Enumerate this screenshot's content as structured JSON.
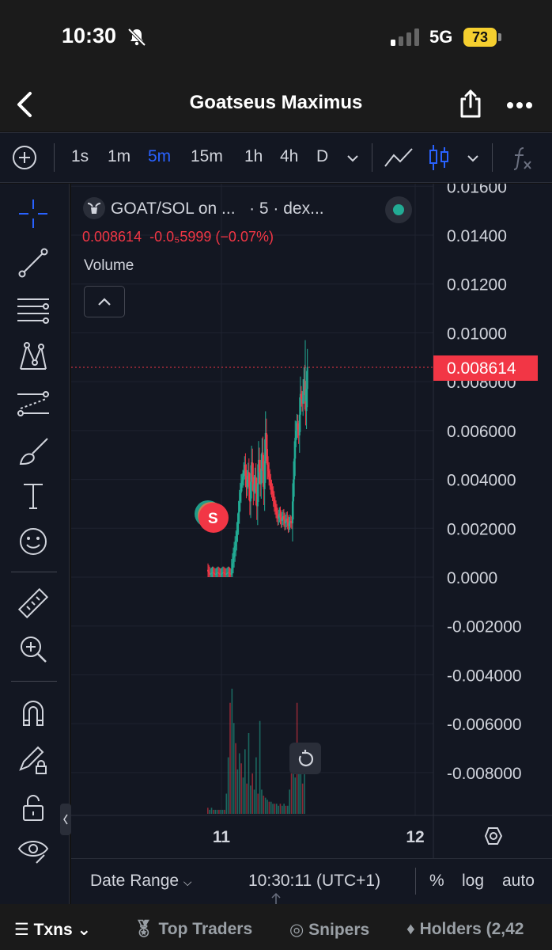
{
  "status_bar": {
    "time": "10:30",
    "network": "5G",
    "battery": "73"
  },
  "header": {
    "title": "Goatseus Maximus"
  },
  "toolbar": {
    "timeframes": [
      "1s",
      "1m",
      "5m",
      "15m",
      "1h",
      "4h",
      "D"
    ],
    "active_timeframe": "5m"
  },
  "legend": {
    "pair": "GOAT/SOL on ...",
    "interval_source": "· 5 · dex...",
    "price": "0.008614",
    "change_abs": "-0.0₅5999",
    "change_pct": "(−0.07%)",
    "volume_label": "Volume"
  },
  "marker": {
    "label": "S"
  },
  "price_tag": "0.008614",
  "bottom": {
    "date_range": "Date Range",
    "clock": "10:30:11 (UTC+1)",
    "percent": "%",
    "log": "log",
    "auto": "auto"
  },
  "tabs": {
    "txns": "Txns",
    "top_traders": "Top Traders",
    "snipers": "Snipers",
    "holders": "Holders (2,42"
  },
  "colors": {
    "up": "#22ab94",
    "down": "#f23645",
    "accent": "#2962ff",
    "background": "#131722"
  },
  "chart_data": {
    "type": "candlestick",
    "y_ticks": [
      "0.01600",
      "0.01400",
      "0.01200",
      "0.01000",
      "0.008000",
      "0.006000",
      "0.004000",
      "0.002000",
      "0.0000",
      "-0.002000",
      "-0.004000",
      "-0.006000",
      "-0.008000"
    ],
    "x_ticks": [
      "11",
      "12"
    ],
    "ylim": [
      -0.0095,
      0.0162
    ],
    "last_price": 0.008614,
    "price_path": [
      [
        0,
        0.0003
      ],
      [
        3,
        0.0001
      ],
      [
        6,
        0.0002
      ],
      [
        9,
        0.0001
      ],
      [
        12,
        0.0002
      ],
      [
        15,
        0.0001
      ],
      [
        18,
        0.0002
      ],
      [
        21,
        0.0001
      ],
      [
        24,
        0.0002
      ],
      [
        27,
        0.0001
      ],
      [
        30,
        0.0008
      ],
      [
        33,
        0.0015
      ],
      [
        35,
        0.0022
      ],
      [
        37,
        0.0031
      ],
      [
        39,
        0.0038
      ],
      [
        41,
        0.0041
      ],
      [
        43,
        0.0046
      ],
      [
        45,
        0.0037
      ],
      [
        47,
        0.0043
      ],
      [
        49,
        0.0031
      ],
      [
        51,
        0.0047
      ],
      [
        53,
        0.0035
      ],
      [
        55,
        0.0041
      ],
      [
        57,
        0.0029
      ],
      [
        59,
        0.0048
      ],
      [
        61,
        0.0038
      ],
      [
        63,
        0.0051
      ],
      [
        65,
        0.0036
      ],
      [
        67,
        0.0059
      ],
      [
        69,
        0.0046
      ],
      [
        71,
        0.0041
      ],
      [
        73,
        0.0037
      ],
      [
        75,
        0.0034
      ],
      [
        77,
        0.003
      ],
      [
        79,
        0.0027
      ],
      [
        81,
        0.0024
      ],
      [
        83,
        0.0026
      ],
      [
        85,
        0.0023
      ],
      [
        87,
        0.0025
      ],
      [
        89,
        0.0022
      ],
      [
        91,
        0.0024
      ],
      [
        93,
        0.0021
      ],
      [
        95,
        0.0023
      ],
      [
        97,
        0.0022
      ],
      [
        99,
        0.004
      ],
      [
        101,
        0.0057
      ],
      [
        103,
        0.0063
      ],
      [
        105,
        0.0058
      ],
      [
        107,
        0.0075
      ],
      [
        109,
        0.0071
      ],
      [
        111,
        0.0081
      ],
      [
        113,
        0.0068
      ],
      [
        115,
        0.0086
      ]
    ],
    "volume": [
      0.03,
      0.02,
      0.03,
      0.02,
      0.02,
      0.02,
      0.02,
      0.02,
      0.02,
      0.02,
      0.1,
      0.28,
      0.55,
      0.62,
      0.45,
      0.35,
      0.22,
      0.3,
      0.25,
      0.18,
      0.32,
      0.15,
      0.4,
      0.14,
      0.2,
      0.12,
      0.28,
      0.1,
      0.46,
      0.12,
      0.09,
      0.08,
      0.07,
      0.06,
      0.06,
      0.05,
      0.05,
      0.05,
      0.04,
      0.05,
      0.04,
      0.05,
      0.04,
      0.04,
      0.12,
      0.2,
      0.26,
      0.18,
      0.55,
      0.3,
      0.2,
      0.15,
      0.22
    ]
  }
}
